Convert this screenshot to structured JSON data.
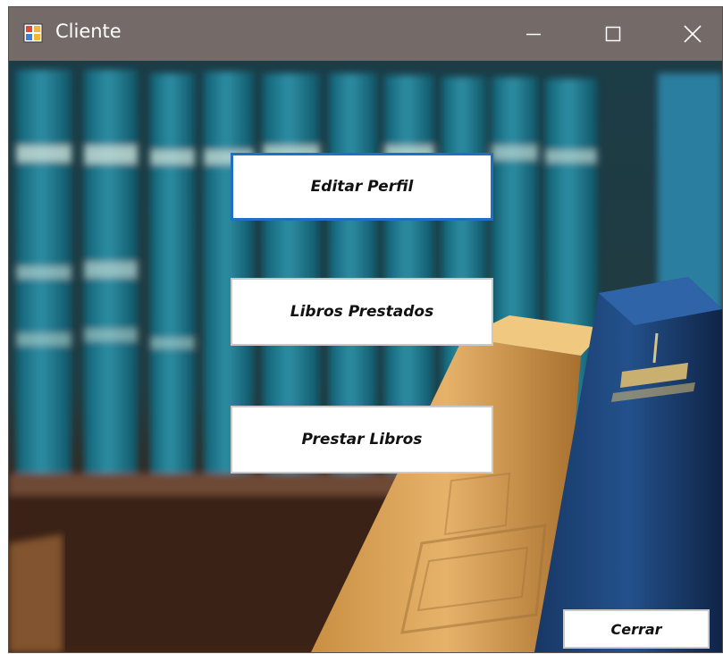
{
  "window": {
    "title": "Cliente",
    "app_icon": "winforms-app-icon",
    "controls": {
      "minimize_icon": "minimize-icon",
      "maximize_icon": "maximize-icon",
      "close_icon": "close-icon"
    }
  },
  "main": {
    "buttons": {
      "editar_perfil": "Editar Perfil",
      "libros_prestados": "Libros Prestados",
      "prestar_libros": "Prestar Libros",
      "cerrar": "Cerrar"
    },
    "focused_button": "Editar Perfil"
  },
  "colors": {
    "titlebar": "#746a68",
    "focus_border": "#1f6fc2",
    "button_bg": "#ffffff"
  }
}
